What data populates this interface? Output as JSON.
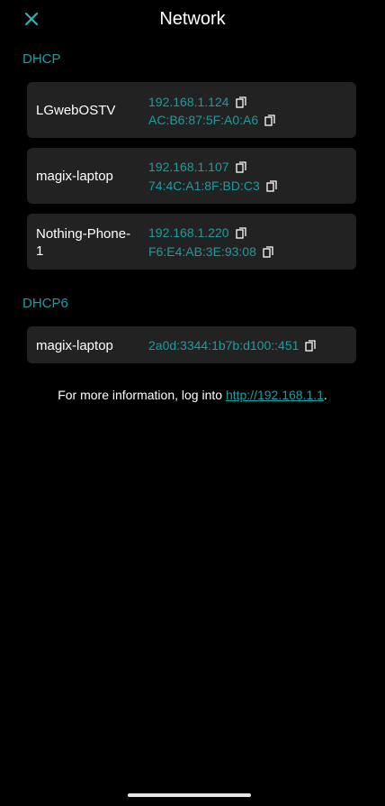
{
  "header": {
    "title": "Network",
    "close_icon": "close-icon",
    "accent_color": "#1f9c9c"
  },
  "dhcp": {
    "label": "DHCP",
    "devices": [
      {
        "name": "LGwebOSTV",
        "ip": "192.168.1.124",
        "mac": "AC:B6:87:5F:A0:A6"
      },
      {
        "name": "magix-laptop",
        "ip": "192.168.1.107",
        "mac": "74:4C:A1:8F:BD:C3"
      },
      {
        "name": "Nothing-Phone-1",
        "ip": "192.168.1.220",
        "mac": "F6:E4:AB:3E:93:08"
      }
    ]
  },
  "dhcp6": {
    "label": "DHCP6",
    "devices": [
      {
        "name": "magix-laptop",
        "ip": "2a0d:3344:1b7b:d100::451"
      }
    ]
  },
  "footer": {
    "text_before": "For more information, log into ",
    "link": "http://192.168.1.1",
    "text_after": "."
  }
}
